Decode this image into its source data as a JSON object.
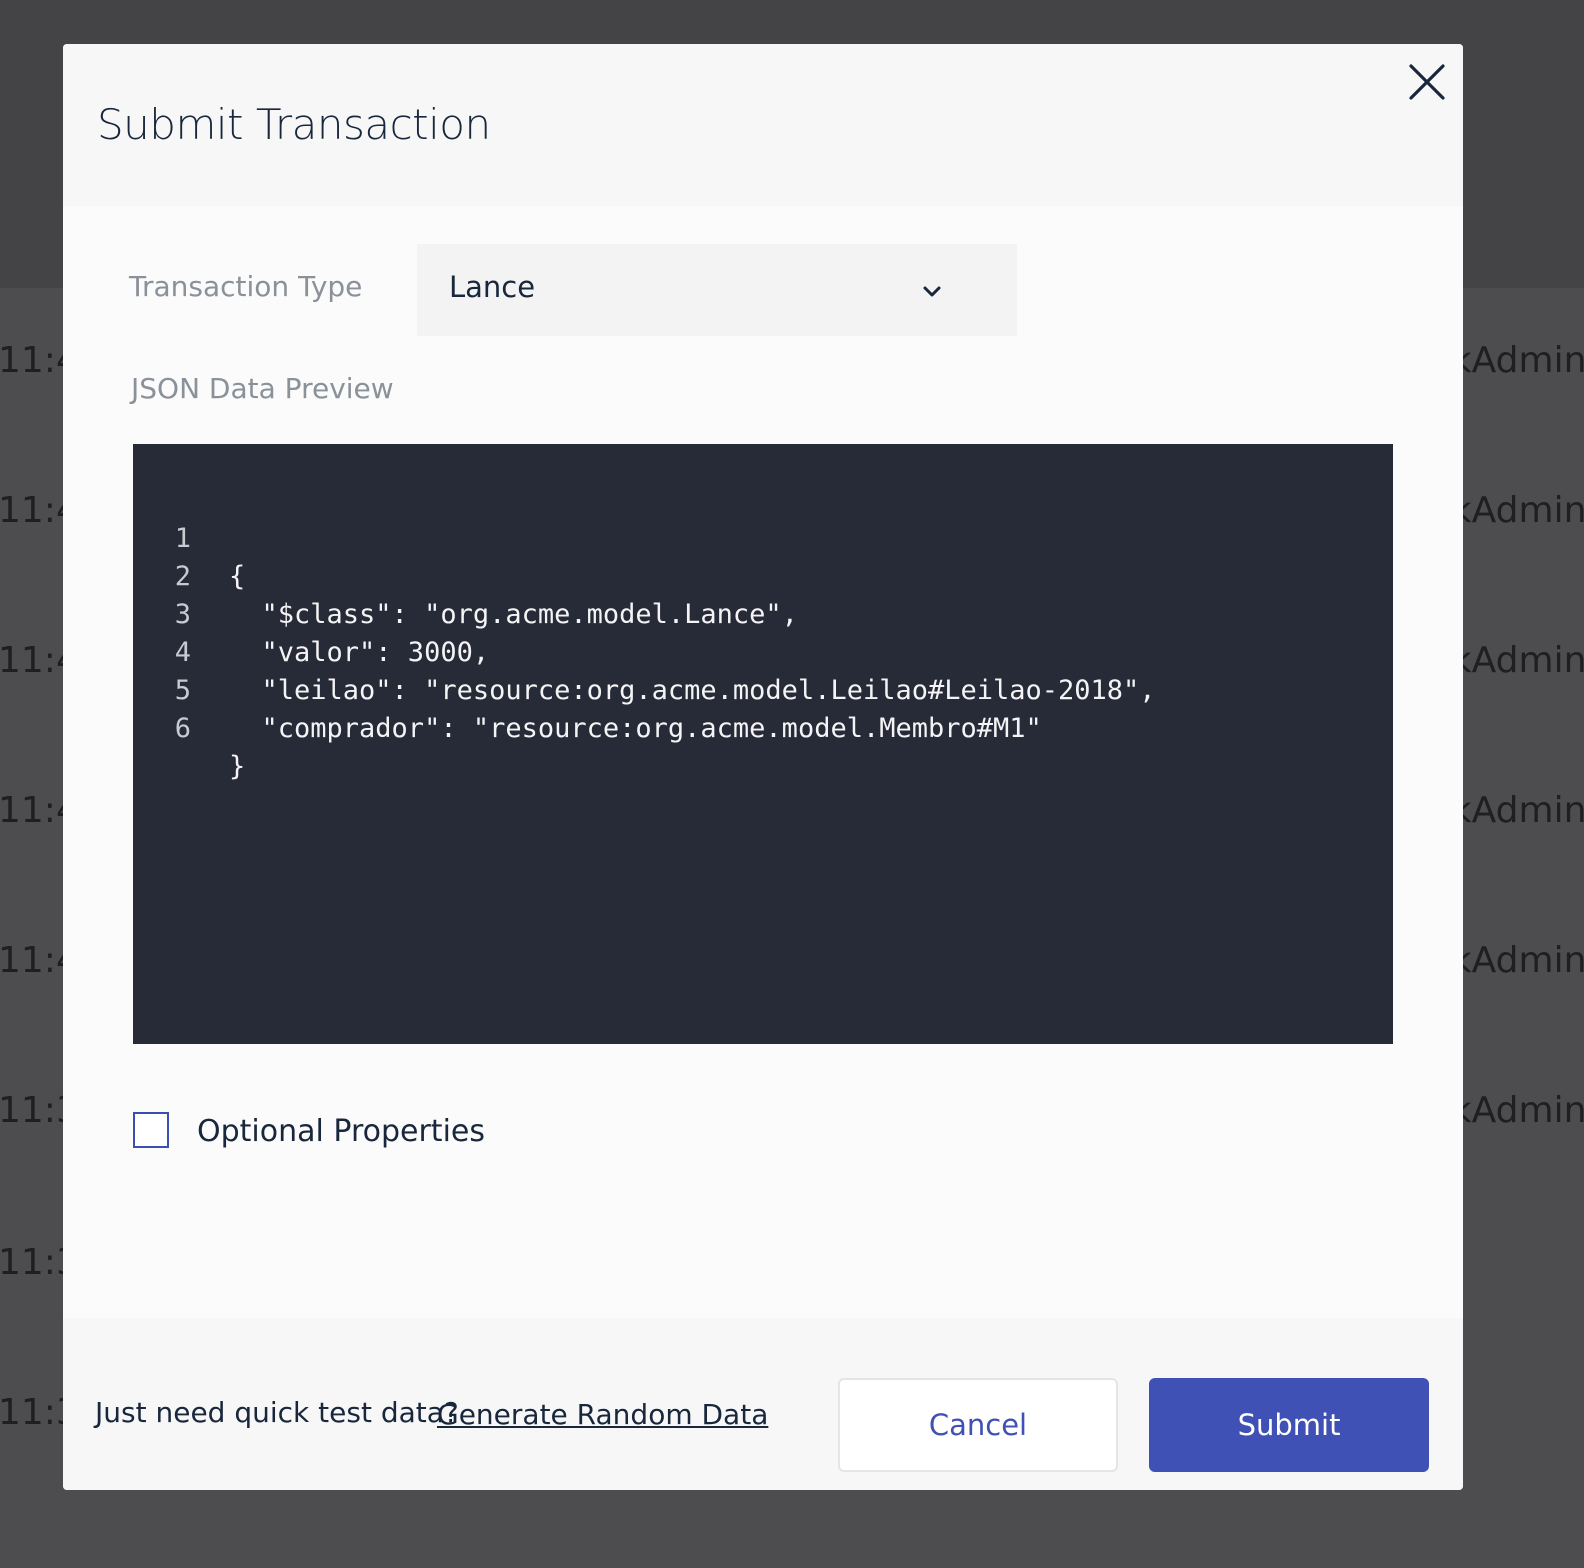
{
  "background": {
    "rows": [
      {
        "time": "11:4",
        "user": "rkAdmin"
      },
      {
        "time": "11:4",
        "user": "rkAdmin"
      },
      {
        "time": "11:4",
        "user": "rkAdmin"
      },
      {
        "time": "11:4",
        "user": "rkAdmin"
      },
      {
        "time": "11:4",
        "user": "rkAdmin"
      },
      {
        "time": "11:3",
        "user": "rkAdmin"
      },
      {
        "time": "11:3",
        "user": ""
      },
      {
        "time": "11:3",
        "user": ""
      }
    ]
  },
  "modal": {
    "title": "Submit Transaction",
    "close_icon": "close-icon"
  },
  "form": {
    "transaction_type_label": "Transaction Type",
    "transaction_type_value": "Lance",
    "json_preview_label": "JSON Data Preview",
    "code_lines": [
      {
        "num": "1",
        "text": "{"
      },
      {
        "num": "2",
        "text": "  \"$class\": \"org.acme.model.Lance\","
      },
      {
        "num": "3",
        "text": "  \"valor\": 3000,"
      },
      {
        "num": "4",
        "text": "  \"leilao\": \"resource:org.acme.model.Leilao#Leilao-2018\","
      },
      {
        "num": "5",
        "text": "  \"comprador\": \"resource:org.acme.model.Membro#M1\""
      },
      {
        "num": "6",
        "text": "}"
      }
    ],
    "optional_properties_label": "Optional Properties",
    "optional_properties_checked": false
  },
  "footer": {
    "quick_text": "Just need quick test data?",
    "generate_link": "Generate Random Data",
    "cancel_label": "Cancel",
    "submit_label": "Submit"
  },
  "colors": {
    "accent": "#3f51b5",
    "code_background": "#272a37",
    "overlay": "#4a4a4c"
  }
}
